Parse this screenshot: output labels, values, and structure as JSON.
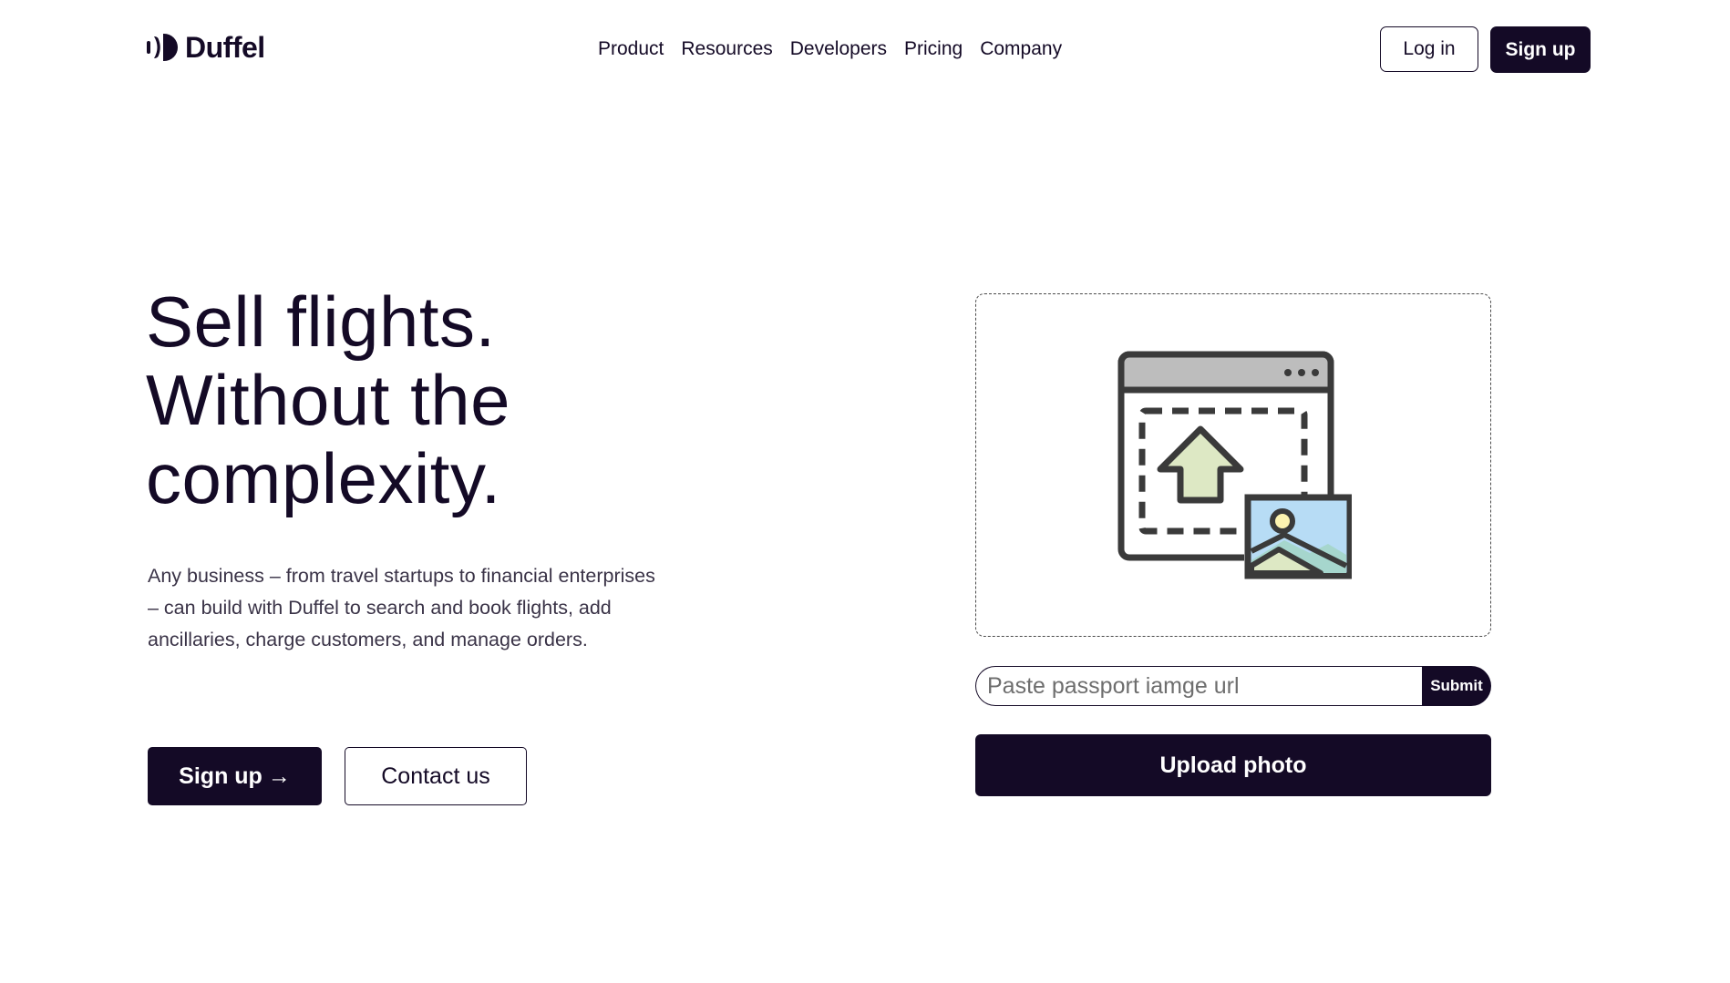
{
  "header": {
    "brand": "Duffel",
    "nav": [
      "Product",
      "Resources",
      "Developers",
      "Pricing",
      "Company"
    ],
    "login_label": "Log in",
    "signup_label": "Sign up"
  },
  "hero": {
    "title_lines": [
      "Sell flights.",
      "Without the",
      "complexity."
    ],
    "description": "Any business – from travel startups to financial enterprises – can build with Duffel to search and book flights, add ancillaries, charge customers, and manage orders.",
    "signup_label": "Sign up",
    "signup_arrow": "→",
    "contact_label": "Contact us"
  },
  "upload": {
    "illustration_icon": "image-upload-icon",
    "url_placeholder": "Paste passport iamge url",
    "url_value": "",
    "submit_label": "Submit",
    "upload_label": "Upload photo"
  },
  "colors": {
    "brand_dark": "#140a26",
    "upload_arrow_fill": "#dde8c4",
    "photo_sky": "#b7dcf5",
    "photo_hills": "#a6d6cd"
  }
}
